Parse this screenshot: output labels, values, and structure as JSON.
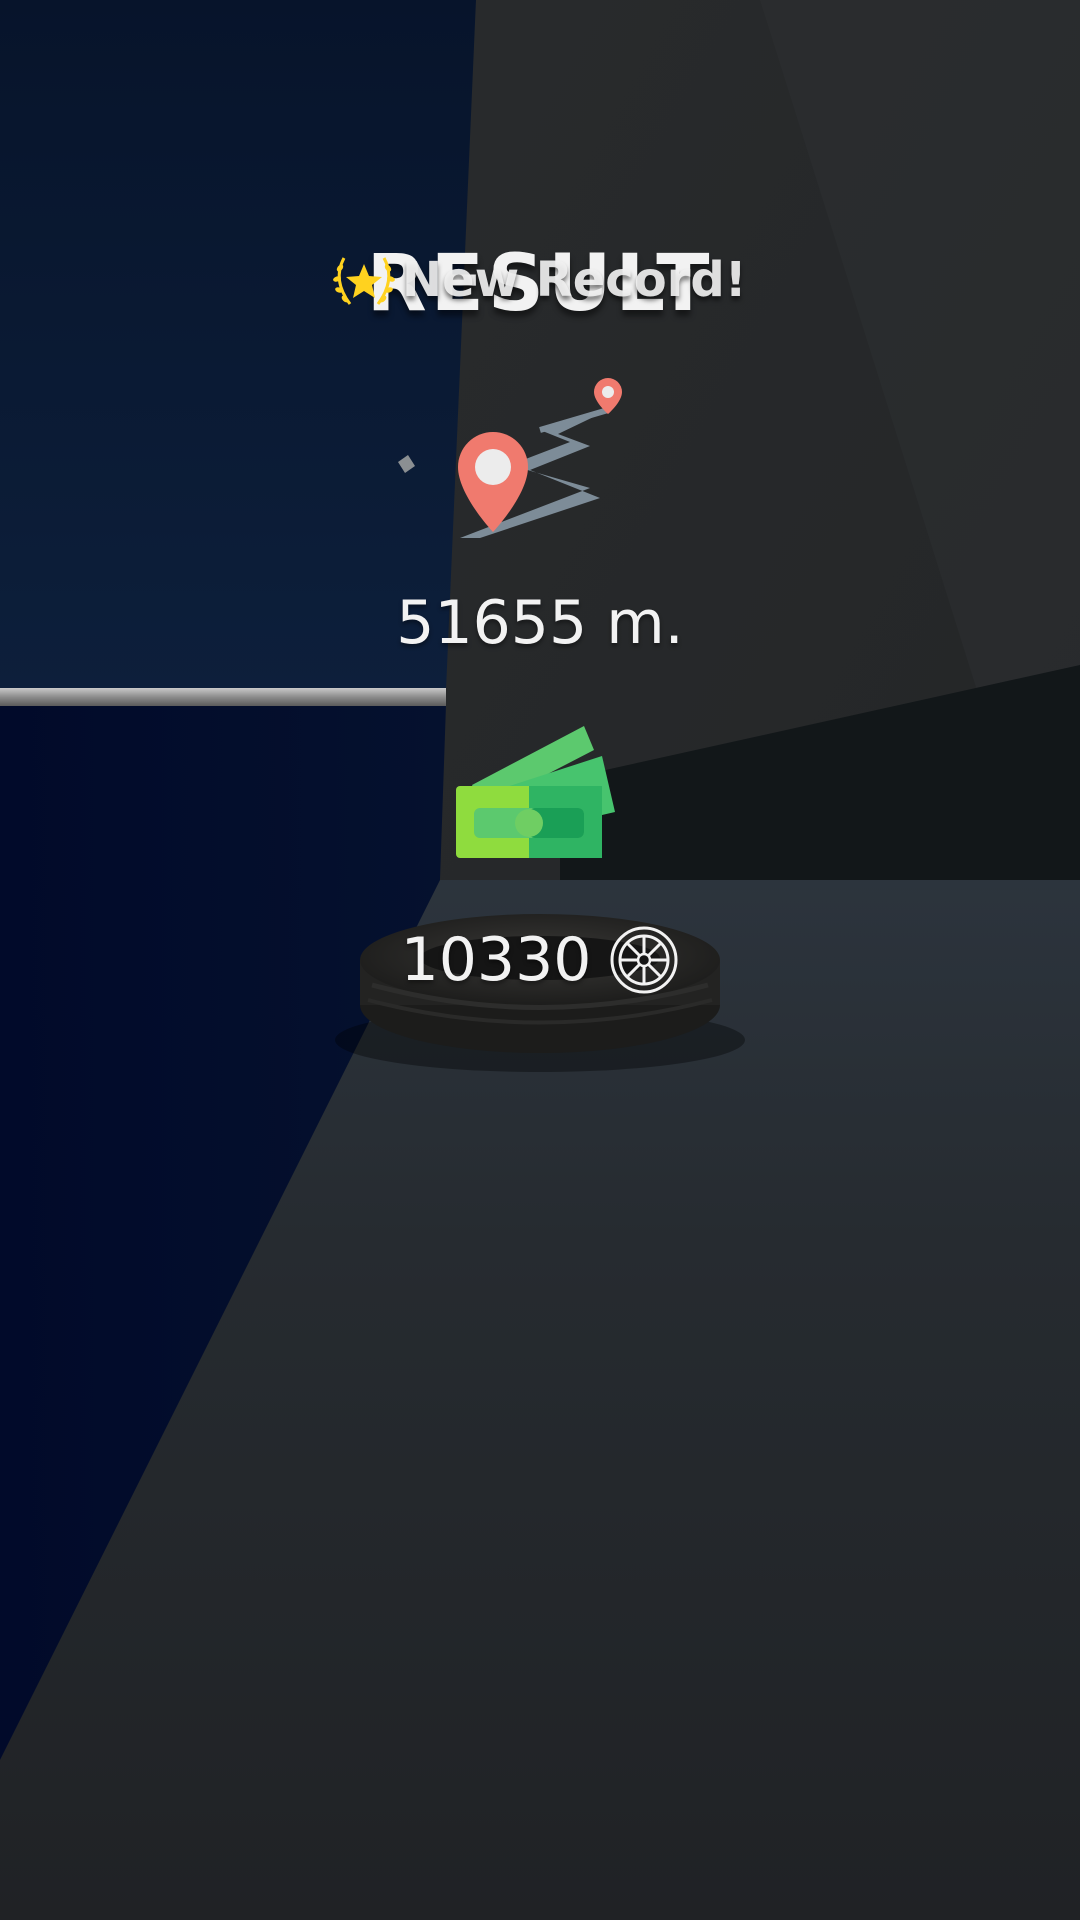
{
  "screen": {
    "title": "RESULT",
    "record_label": "New Record!",
    "distance_text": "51655 m.",
    "coins_text": "10330"
  },
  "icons": {
    "record": "laurel-star-icon",
    "route": "route-map-pin-icon",
    "money": "money-banknotes-icon",
    "currency": "wheel-rim-icon"
  },
  "colors": {
    "title_text": "#f2f2f2",
    "star_yellow": "#ffd21f",
    "pin_red": "#f07a6e",
    "route_gray": "#7d8c98",
    "money_green_light": "#8fdc3e",
    "money_green_dark": "#2fb463",
    "wall_dark_blue": "#0b1a35",
    "floor_dark": "#262a2e"
  }
}
